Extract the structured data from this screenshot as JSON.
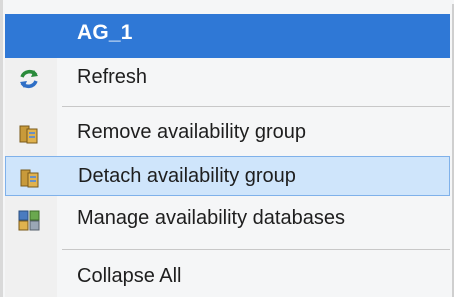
{
  "menu": {
    "header_label": "AG_1",
    "items": [
      {
        "label": "Refresh",
        "icon": "refresh-icon"
      },
      {
        "label": "Remove availability group",
        "icon": "remove-ag-icon"
      },
      {
        "label": "Detach availability group",
        "icon": "detach-ag-icon",
        "highlighted": true
      },
      {
        "label": "Manage availability databases",
        "icon": "manage-databases-icon"
      },
      {
        "label": "Collapse All"
      }
    ]
  },
  "colors": {
    "header_bg": "#2f78d6",
    "highlight_bg": "#cfe5fb",
    "highlight_border": "#7fb1ea"
  }
}
